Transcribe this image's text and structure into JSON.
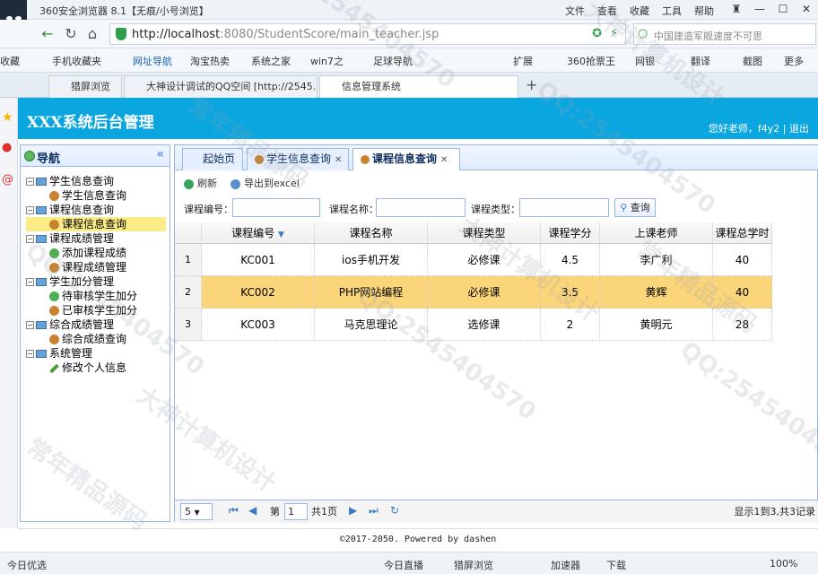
{
  "browser": {
    "title": "360安全浏览器 8.1【无痕/小号浏览】",
    "menus": [
      "文件",
      "查看",
      "收藏",
      "工具",
      "帮助"
    ],
    "url_host": "http://localhost",
    "url_rest": ":8080/StudentScore/main_teacher.jsp",
    "search_placeholder": "中国建造军舰速度不可思",
    "favorites": [
      "收藏",
      "手机收藏夹",
      "网址导航",
      "淘宝热卖",
      "系统之家",
      "win7之",
      "足球导航",
      "扩展",
      "360抢票王",
      "网银",
      "翻译",
      "截图",
      "更多"
    ],
    "tabs": [
      "猎屏浏览",
      "大神设计调试的QQ空间 [http://2545...",
      "信息管理系统"
    ],
    "status": {
      "left": "今日优选",
      "live": "今日直播",
      "capture": "猎屏浏览",
      "accel": "加速器",
      "download": "下载",
      "zoom": "100%"
    }
  },
  "app": {
    "title": "XXX系统后台管理",
    "greeting": "您好老师，f4y2 | 退出",
    "footer": "©2017-2050. Powered by dashen"
  },
  "nav": {
    "title": "导航",
    "groups": [
      {
        "label": "学生信息查询",
        "children": [
          "学生信息查询"
        ]
      },
      {
        "label": "课程信息查询",
        "children": [
          "课程信息查询"
        ]
      },
      {
        "label": "课程成绩管理",
        "children": [
          "添加课程成绩",
          "课程成绩管理"
        ]
      },
      {
        "label": "学生加分管理",
        "children": [
          "待审核学生加分",
          "已审核学生加分"
        ]
      },
      {
        "label": "综合成绩管理",
        "children": [
          "综合成绩查询"
        ]
      },
      {
        "label": "系统管理",
        "children": [
          "修改个人信息"
        ]
      }
    ]
  },
  "content": {
    "tabs": [
      {
        "label": "起始页"
      },
      {
        "label": "学生信息查询"
      },
      {
        "label": "课程信息查询"
      }
    ],
    "toolbar": {
      "refresh": "刷新",
      "export": "导出到excel"
    },
    "filters": {
      "course_no": "课程编号：",
      "course_name": "课程名称：",
      "course_type": "课程类型：",
      "search": "查询"
    },
    "columns": [
      "课程编号",
      "课程名称",
      "课程类型",
      "课程学分",
      "上课老师",
      "课程总学时"
    ],
    "rows": [
      {
        "no": "1",
        "cells": [
          "KC001",
          "ios手机开发",
          "必修课",
          "4.5",
          "李广利",
          "40"
        ]
      },
      {
        "no": "2",
        "cells": [
          "KC002",
          "PHP网站编程",
          "必修课",
          "3.5",
          "黄辉",
          "40"
        ]
      },
      {
        "no": "3",
        "cells": [
          "KC003",
          "马克思理论",
          "选修课",
          "2",
          "黄明元",
          "28"
        ]
      }
    ],
    "pager": {
      "page_size": "5",
      "page_prefix": "第",
      "page_value": "1",
      "page_suffix": "共1页",
      "summary": "显示1到3,共3记录"
    }
  },
  "watermark": [
    "QQ:2545404570",
    "大神计算机设计",
    "常年精品源码"
  ]
}
